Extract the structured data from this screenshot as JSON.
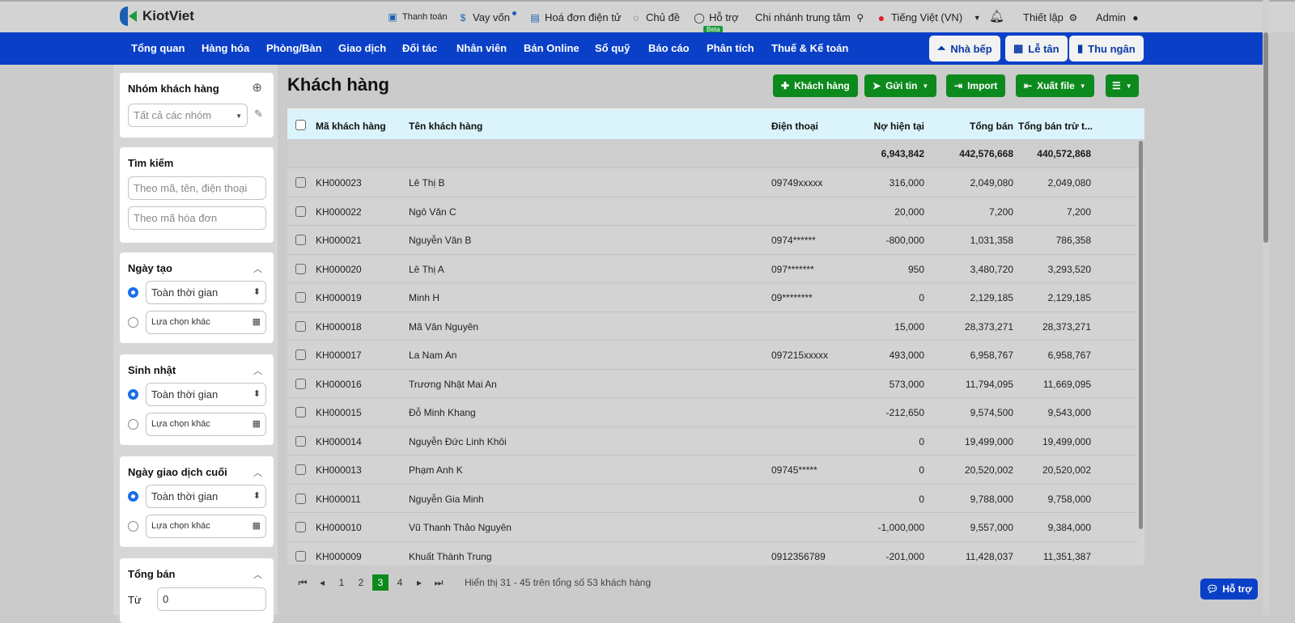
{
  "topbar": {
    "brand": "KiotViet",
    "links": [
      {
        "label": "Thanh toán",
        "icon": "wallet-icon"
      },
      {
        "label": "Vay vốn",
        "icon": "money-bag-icon"
      },
      {
        "label": "Hoá đơn điện tử",
        "icon": "invoice-icon"
      },
      {
        "label": "Chủ đề",
        "icon": "palette-icon"
      },
      {
        "label": "Hỗ trợ",
        "icon": "chat-icon"
      }
    ],
    "beta": "Beta",
    "branch": "Chi nhánh trung tâm",
    "language": "Tiếng Việt (VN)",
    "settings": "Thiết lập",
    "user": "Admin"
  },
  "nav": {
    "items": [
      "Tổng quan",
      "Hàng hóa",
      "Phòng/Bàn",
      "Giao dịch",
      "Đối tác",
      "Nhân viên",
      "Bán Online",
      "Sổ quỹ",
      "Báo cáo",
      "Phân tích",
      "Thuế & Kế toán"
    ],
    "buttons": [
      "Nhà bếp",
      "Lễ tân",
      "Thu ngân"
    ]
  },
  "sidebar": {
    "group": {
      "title": "Nhóm khách hàng",
      "value": "Tất cả các nhóm"
    },
    "search": {
      "title": "Tìm kiếm",
      "placeholder1": "Theo mã, tên, điện thoại",
      "placeholder2": "Theo mã hóa đơn"
    },
    "created": {
      "title": "Ngày tạo",
      "opt1": "Toàn thời gian",
      "opt2": "Lựa chọn khác"
    },
    "birthday": {
      "title": "Sinh nhật",
      "opt1": "Toàn thời gian",
      "opt2": "Lựa chọn khác"
    },
    "lastTx": {
      "title": "Ngày giao dịch cuối",
      "opt1": "Toàn thời gian",
      "opt2": "Lựa chọn khác"
    },
    "totalSales": {
      "title": "Tổng bán",
      "from_label": "Từ",
      "from_value": "0"
    }
  },
  "main": {
    "title": "Khách hàng",
    "buttons": [
      "Khách hàng",
      "Gửi tin",
      "Import",
      "Xuất file"
    ],
    "columns": [
      "Mã khách hàng",
      "Tên khách hàng",
      "Điện thoại",
      "Nợ hiện tại",
      "Tổng bán",
      "Tổng bán trừ t..."
    ],
    "summary": {
      "debt": "6,943,842",
      "total": "442,576,668",
      "net": "440,572,868"
    },
    "rows": [
      [
        "KH000023",
        "Lê Thị B",
        "09749xxxxx",
        "316,000",
        "2,049,080",
        "2,049,080"
      ],
      [
        "KH000022",
        "Ngô Văn C",
        "",
        "20,000",
        "7,200",
        "7,200"
      ],
      [
        "KH000021",
        "Nguyễn Văn B",
        "0974******",
        "-800,000",
        "1,031,358",
        "786,358"
      ],
      [
        "KH000020",
        "Lê Thị A",
        "097*******",
        "950",
        "3,480,720",
        "3,293,520"
      ],
      [
        "KH000019",
        "Minh H",
        "09********",
        "0",
        "2,129,185",
        "2,129,185"
      ],
      [
        "KH000018",
        "Mã Vân Nguyên",
        "",
        "15,000",
        "28,373,271",
        "28,373,271"
      ],
      [
        "KH000017",
        "La Nam An",
        "097215xxxxx",
        "493,000",
        "6,958,767",
        "6,958,767"
      ],
      [
        "KH000016",
        "Trương Nhật Mai An",
        "",
        "573,000",
        "11,794,095",
        "11,669,095"
      ],
      [
        "KH000015",
        "Đỗ Minh Khang",
        "",
        "-212,650",
        "9,574,500",
        "9,543,000"
      ],
      [
        "KH000014",
        "Nguyễn Đức Linh Khôi",
        "",
        "0",
        "19,499,000",
        "19,499,000"
      ],
      [
        "KH000013",
        "Phạm Anh K",
        "09745*****",
        "0",
        "20,520,002",
        "20,520,002"
      ],
      [
        "KH000011",
        "Nguyễn Gia Minh",
        "",
        "0",
        "9,788,000",
        "9,758,000"
      ],
      [
        "KH000010",
        "Vũ Thanh Thảo Nguyên",
        "",
        "-1,000,000",
        "9,557,000",
        "9,384,000"
      ],
      [
        "KH000009",
        "Khuất Thành Trung",
        "0912356789",
        "-201,000",
        "11,428,037",
        "11,351,387"
      ]
    ],
    "pagination": {
      "pages": [
        "1",
        "2",
        "3",
        "4"
      ],
      "current": "3",
      "info": "Hiển thị 31 - 45 trên tổng số 53 khách hàng"
    }
  },
  "help_button": "Hỗ trợ"
}
